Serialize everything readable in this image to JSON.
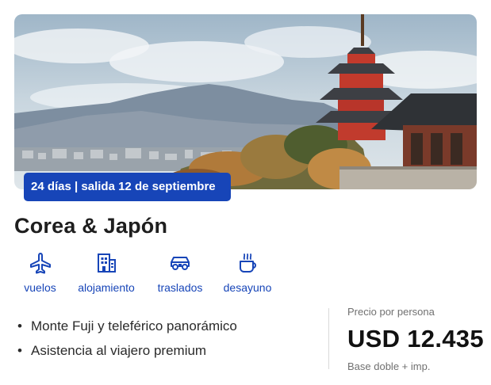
{
  "tour": {
    "badge": "24 días | salida 12 de septiembre",
    "title": "Corea & Japón",
    "image_icon": "pagoda-landscape-photo"
  },
  "amenities": [
    {
      "label": "vuelos",
      "icon": "airplane-icon"
    },
    {
      "label": "alojamiento",
      "icon": "building-icon"
    },
    {
      "label": "traslados",
      "icon": "car-icon"
    },
    {
      "label": "desayuno",
      "icon": "coffee-icon"
    }
  ],
  "features": [
    "Monte Fuji y teleférico panorámico",
    "Asistencia al viajero premium"
  ],
  "price": {
    "label": "Precio por persona",
    "value": "USD 12.435",
    "note": "Base doble + imp."
  },
  "colors": {
    "accent": "#1745b8",
    "text": "#1e1e1e",
    "muted": "#707070"
  }
}
